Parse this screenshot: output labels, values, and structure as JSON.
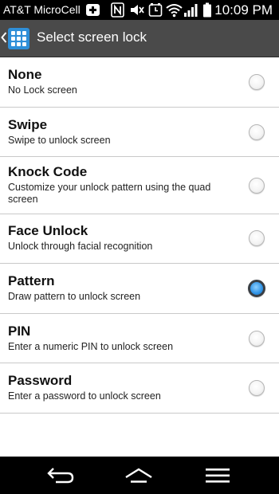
{
  "status_bar": {
    "carrier": "AT&T MicroCell",
    "time": "10:09 PM",
    "icons": [
      "microcell-plus-icon",
      "nfc-icon",
      "mute-icon",
      "alarm-icon",
      "wifi-icon",
      "signal-icon",
      "battery-icon"
    ]
  },
  "action_bar": {
    "title": "Select screen lock",
    "icon": "pattern-grid-icon",
    "accent": "#2f8fd8"
  },
  "options": [
    {
      "title": "None",
      "subtitle": "No Lock screen",
      "selected": false
    },
    {
      "title": "Swipe",
      "subtitle": "Swipe to unlock screen",
      "selected": false
    },
    {
      "title": "Knock Code",
      "subtitle": "Customize your unlock pattern using the quad screen",
      "selected": false
    },
    {
      "title": "Face Unlock",
      "subtitle": "Unlock through facial recognition",
      "selected": false
    },
    {
      "title": "Pattern",
      "subtitle": "Draw pattern to unlock screen",
      "selected": true
    },
    {
      "title": "PIN",
      "subtitle": "Enter a numeric PIN to unlock screen",
      "selected": false
    },
    {
      "title": "Password",
      "subtitle": "Enter a password to unlock screen",
      "selected": false
    }
  ],
  "nav_bar": {
    "icons": [
      "back-icon",
      "home-icon",
      "menu-icon"
    ]
  }
}
